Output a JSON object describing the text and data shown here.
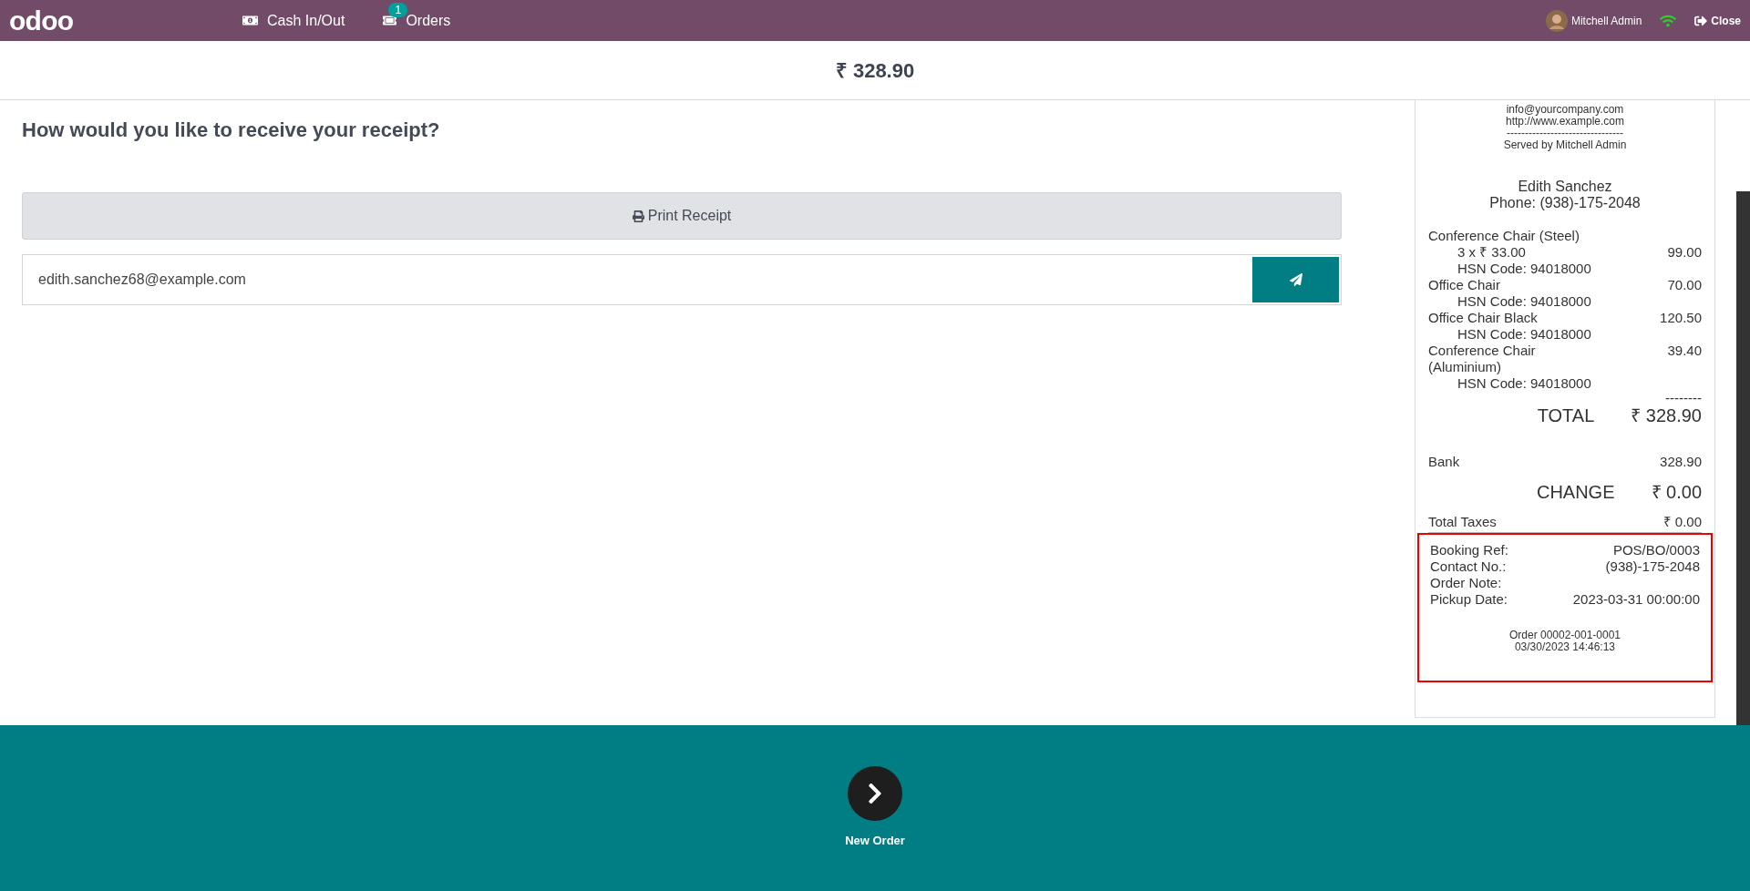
{
  "navbar": {
    "logo": "odoo",
    "items": [
      {
        "kind": "cash",
        "label": "Cash In/Out"
      },
      {
        "kind": "orders",
        "label": "Orders",
        "badge": "1"
      }
    ],
    "user": "Mitchell Admin",
    "close": "Close"
  },
  "amount": "₹ 328.90",
  "prompt": {
    "title": "How would you like to receive your receipt?",
    "print_button": "Print Receipt",
    "email": "edith.sanchez68@example.com"
  },
  "receipt": {
    "header_lines": [
      "info@yourcompany.com",
      "http://www.example.com",
      "--------------------------------",
      "Served by Mitchell Admin"
    ],
    "customer": "Edith Sanchez",
    "phone": "Phone: (938)-175-2048",
    "lines": [
      {
        "name": "Conference Chair (Steel)",
        "detail": "3 x ₹ 33.00",
        "amount": "99.00",
        "hsn": "HSN Code: 94018000"
      },
      {
        "name": "Office Chair",
        "amount": "70.00",
        "hsn": "HSN Code: 94018000"
      },
      {
        "name": "Office Chair Black",
        "amount": "120.50",
        "hsn": "HSN Code: 94018000"
      },
      {
        "name": "Conference Chair (Aluminium)",
        "amount": "39.40",
        "hsn": "HSN Code: 94018000"
      }
    ],
    "separator": "--------",
    "total_label": "TOTAL",
    "total": "₹ 328.90",
    "payments": [
      {
        "name": "Bank",
        "amount": "328.90"
      }
    ],
    "change_label": "CHANGE",
    "change": "₹ 0.00",
    "taxes_label": "Total Taxes",
    "taxes": "₹ 0.00",
    "booking": [
      {
        "label": "Booking Ref:",
        "value": "POS/BO/0003"
      },
      {
        "label": "Contact No.:",
        "value": "(938)-175-2048"
      },
      {
        "label": "Order Note:"
      },
      {
        "label": "Pickup Date:",
        "value": "2023-03-31 00:00:00"
      }
    ],
    "order_ref": "Order 00002-001-0001",
    "datetime": "03/30/2023 14:46:13"
  },
  "footer": {
    "new_order": "New Order"
  }
}
